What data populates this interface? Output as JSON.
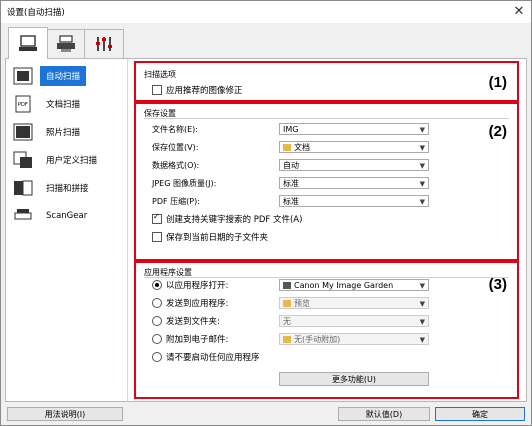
{
  "window": {
    "title": "设置(自动扫描)"
  },
  "tabs": [
    {
      "icon": "computer-icon"
    },
    {
      "icon": "scanner-icon"
    },
    {
      "icon": "tools-icon"
    }
  ],
  "sidebar": {
    "items": [
      {
        "label": "自动扫描",
        "icon": "auto-scan-icon"
      },
      {
        "label": "文档扫描",
        "icon": "document-scan-icon"
      },
      {
        "label": "照片扫描",
        "icon": "photo-scan-icon"
      },
      {
        "label": "用户定义扫描",
        "icon": "custom-scan-icon"
      },
      {
        "label": "扫描和拼接",
        "icon": "stitch-scan-icon"
      },
      {
        "label": "ScanGear",
        "icon": "scangear-icon"
      }
    ]
  },
  "scan_options": {
    "title": "扫描选项",
    "number": "(1)",
    "apply_correction": "应用推荐的图像修正"
  },
  "save_settings": {
    "title": "保存设置",
    "number": "(2)",
    "file_name_label": "文件名称(E):",
    "file_name_value": "IMG",
    "save_in_label": "保存位置(V):",
    "save_in_value": "文档",
    "data_format_label": "数据格式(O):",
    "data_format_value": "自动",
    "jpeg_quality_label": "JPEG 图像质量(J):",
    "jpeg_quality_value": "标准",
    "pdf_compression_label": "PDF 压缩(P):",
    "pdf_compression_value": "标准",
    "create_pdf_keyword": "创建支持关键字搜索的 PDF 文件(A)",
    "save_to_subfolder": "保存到当前日期的子文件夹"
  },
  "app_settings": {
    "title": "应用程序设置",
    "number": "(3)",
    "open_with_label": "以应用程序打开:",
    "open_with_value": "Canon My Image Garden",
    "send_to_app_label": "发送到应用程序:",
    "send_to_app_value": "预览",
    "send_to_folder_label": "发送到文件夹:",
    "send_to_folder_value": "无",
    "attach_email_label": "附加到电子邮件:",
    "attach_email_value": "无(手动附加)",
    "no_app_label": "请不要启动任何应用程序",
    "more_functions": "更多功能(U)"
  },
  "footer": {
    "help": "用法说明(I)",
    "defaults": "默认值(D)",
    "ok": "确定"
  },
  "colors": {
    "accent": "#1e74d6",
    "highlight": "#e0001a"
  }
}
